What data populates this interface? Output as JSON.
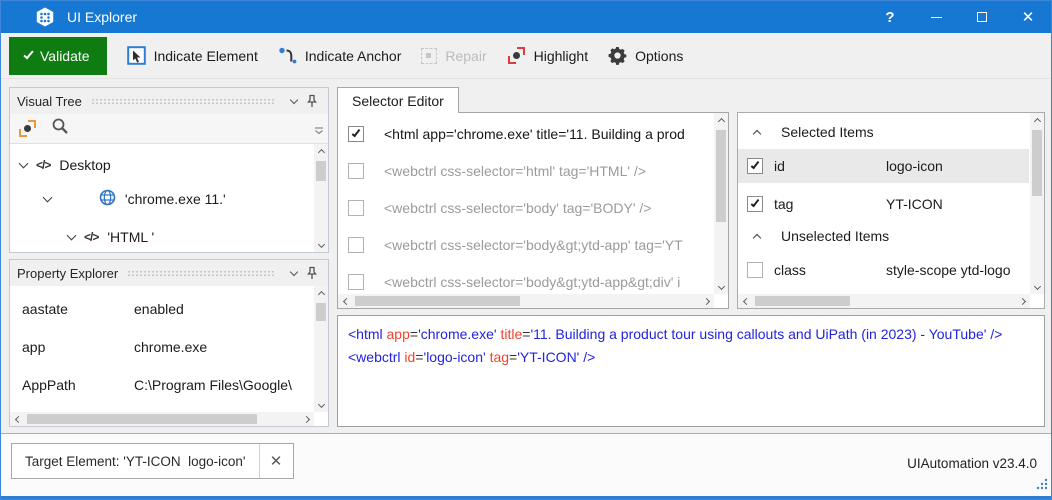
{
  "window": {
    "title": "UI Explorer",
    "help_label": "?",
    "version": "UIAutomation v23.4.0"
  },
  "toolbar": {
    "validate": "Validate",
    "indicate_element": "Indicate Element",
    "indicate_anchor": "Indicate Anchor",
    "repair": "Repair",
    "highlight": "Highlight",
    "options": "Options"
  },
  "visual_tree": {
    "title": "Visual Tree",
    "nodes": [
      {
        "label": "Desktop"
      },
      {
        "label": "'chrome.exe 11.'"
      },
      {
        "label": "'HTML '"
      }
    ]
  },
  "property_explorer": {
    "title": "Property Explorer",
    "rows": [
      {
        "name": "aastate",
        "value": "enabled"
      },
      {
        "name": "app",
        "value": "chrome.exe"
      },
      {
        "name": "AppPath",
        "value": "C:\\Program Files\\Google\\"
      }
    ]
  },
  "selector_editor": {
    "tab_label": "Selector Editor",
    "rows": [
      {
        "checked": true,
        "text": "<html app='chrome.exe' title='11. Building a prod"
      },
      {
        "checked": false,
        "text": "<webctrl css-selector='html' tag='HTML' />"
      },
      {
        "checked": false,
        "text": "<webctrl css-selector='body' tag='BODY' />"
      },
      {
        "checked": false,
        "text": "<webctrl css-selector='body&gt;ytd-app' tag='YT"
      },
      {
        "checked": false,
        "text": "<webctrl css-selector='body&gt;ytd-app&gt;div' i"
      }
    ]
  },
  "attributes_panel": {
    "selected_header": "Selected Items",
    "unselected_header": "Unselected Items",
    "rows": {
      "id": {
        "name": "id",
        "value": "logo-icon"
      },
      "tag": {
        "name": "tag",
        "value": "YT-ICON"
      },
      "class": {
        "name": "class",
        "value": "style-scope ytd-logo"
      }
    }
  },
  "xml_editor": {
    "line1": [
      "<html ",
      "app",
      "=",
      "'chrome.exe' ",
      "title",
      "=",
      "'11. Building a product tour using callouts and UiPath (in 2023) - YouTube' ",
      "/>"
    ],
    "line2": [
      "<webctrl ",
      "id",
      "=",
      "'logo-icon' ",
      "tag",
      "=",
      "'YT-ICON' ",
      "/>"
    ]
  },
  "statusbar": {
    "target_element": "Target Element: 'YT-ICON  logo-icon'"
  },
  "icons": {
    "code": "</>"
  },
  "colors": {
    "titlebar": "#1778d4",
    "validate_green": "#0e7c10",
    "indicate_blue": "#2d7dd2",
    "highlight_red": "#e0393e",
    "tree_target_orange": "#e89a3c",
    "xml_tag_blue": "#2323dd",
    "xml_attr_red": "#f0442c"
  }
}
